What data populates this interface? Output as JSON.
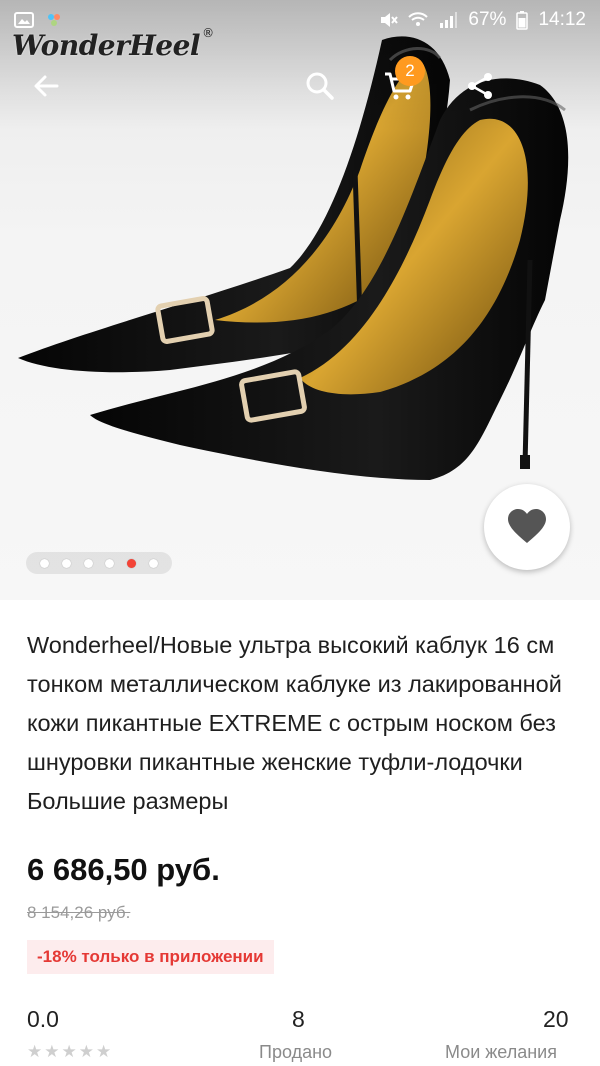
{
  "status_bar": {
    "battery": "67%",
    "time": "14:12"
  },
  "brand": {
    "name": "WonderHeel",
    "registered": "®"
  },
  "toolbar": {
    "back_icon": "arrow-left-icon",
    "search_icon": "search-icon",
    "cart_icon": "cart-icon",
    "share_icon": "share-icon",
    "cart_count": "2"
  },
  "gallery": {
    "total_images": 6,
    "active_index": 5
  },
  "product": {
    "title": "Wonderheel/Новые ультра высокий каблук 16 см тонком металлическом каблуке из лакированной кожи пикантные EXTREME с острым носком без шнуровки пикантные женские туфли-лодочки Большие размеры",
    "price": "6 686,50 руб.",
    "old_price": "8 154,26 руб.",
    "promo": "-18% только в приложении"
  },
  "stats": {
    "rating": "0.0",
    "rating_stars": "★★★★★",
    "sold_count": "8",
    "sold_label": "Продано",
    "wishlist_count": "20",
    "wishlist_label": "Мои желания"
  },
  "colors": {
    "accent_red": "#f44336",
    "badge_orange": "#ff9a1f",
    "promo_bg": "#fdeced",
    "promo_text": "#e53935"
  }
}
